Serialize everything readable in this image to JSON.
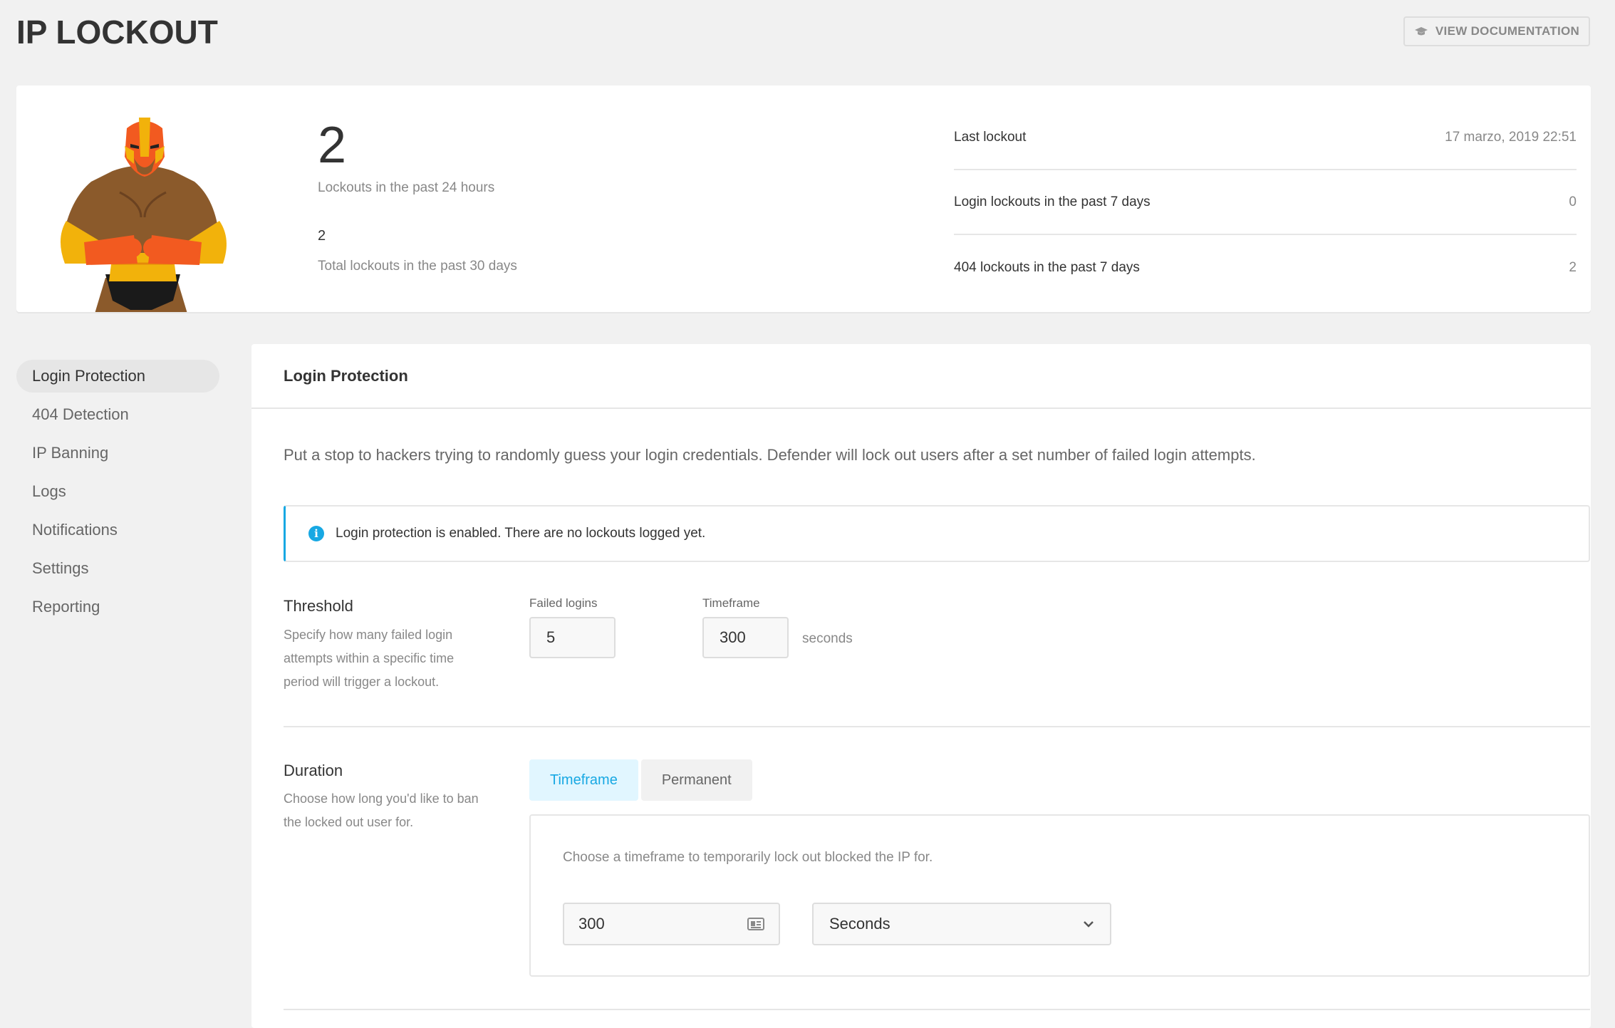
{
  "page": {
    "title": "IP LOCKOUT",
    "doc_button": "VIEW DOCUMENTATION"
  },
  "summary": {
    "lockouts_24h": "2",
    "lockouts_24h_label": "Lockouts in the past 24 hours",
    "lockouts_30d": "2",
    "lockouts_30d_label": "Total lockouts in the past 30 days",
    "stats": [
      {
        "label": "Last lockout",
        "value": "17 marzo, 2019 22:51"
      },
      {
        "label": "Login lockouts in the past 7 days",
        "value": "0"
      },
      {
        "label": "404 lockouts in the past 7 days",
        "value": "2"
      }
    ]
  },
  "sidebar": {
    "items": [
      {
        "label": "Login Protection",
        "active": true
      },
      {
        "label": "404 Detection"
      },
      {
        "label": "IP Banning"
      },
      {
        "label": "Logs"
      },
      {
        "label": "Notifications"
      },
      {
        "label": "Settings"
      },
      {
        "label": "Reporting"
      }
    ]
  },
  "panel": {
    "title": "Login Protection",
    "description": "Put a stop to hackers trying to randomly guess your login credentials. Defender will lock out users after a set number of failed login attempts.",
    "notice": "Login protection is enabled. There are no lockouts logged yet.",
    "threshold": {
      "title": "Threshold",
      "description": "Specify how many failed login attempts within a specific time period will trigger a lockout.",
      "failed_logins_label": "Failed logins",
      "failed_logins_value": "5",
      "timeframe_label": "Timeframe",
      "timeframe_value": "300",
      "unit": "seconds"
    },
    "duration": {
      "title": "Duration",
      "description": "Choose how long you'd like to ban the locked out user for.",
      "tabs": [
        "Timeframe",
        "Permanent"
      ],
      "active_tab": "Timeframe",
      "box_description": "Choose a timeframe to temporarily lock out blocked the IP for.",
      "value": "300",
      "unit_selected": "Seconds"
    }
  },
  "colors": {
    "accent": "#17a8e3",
    "background": "#f1f1f1"
  }
}
